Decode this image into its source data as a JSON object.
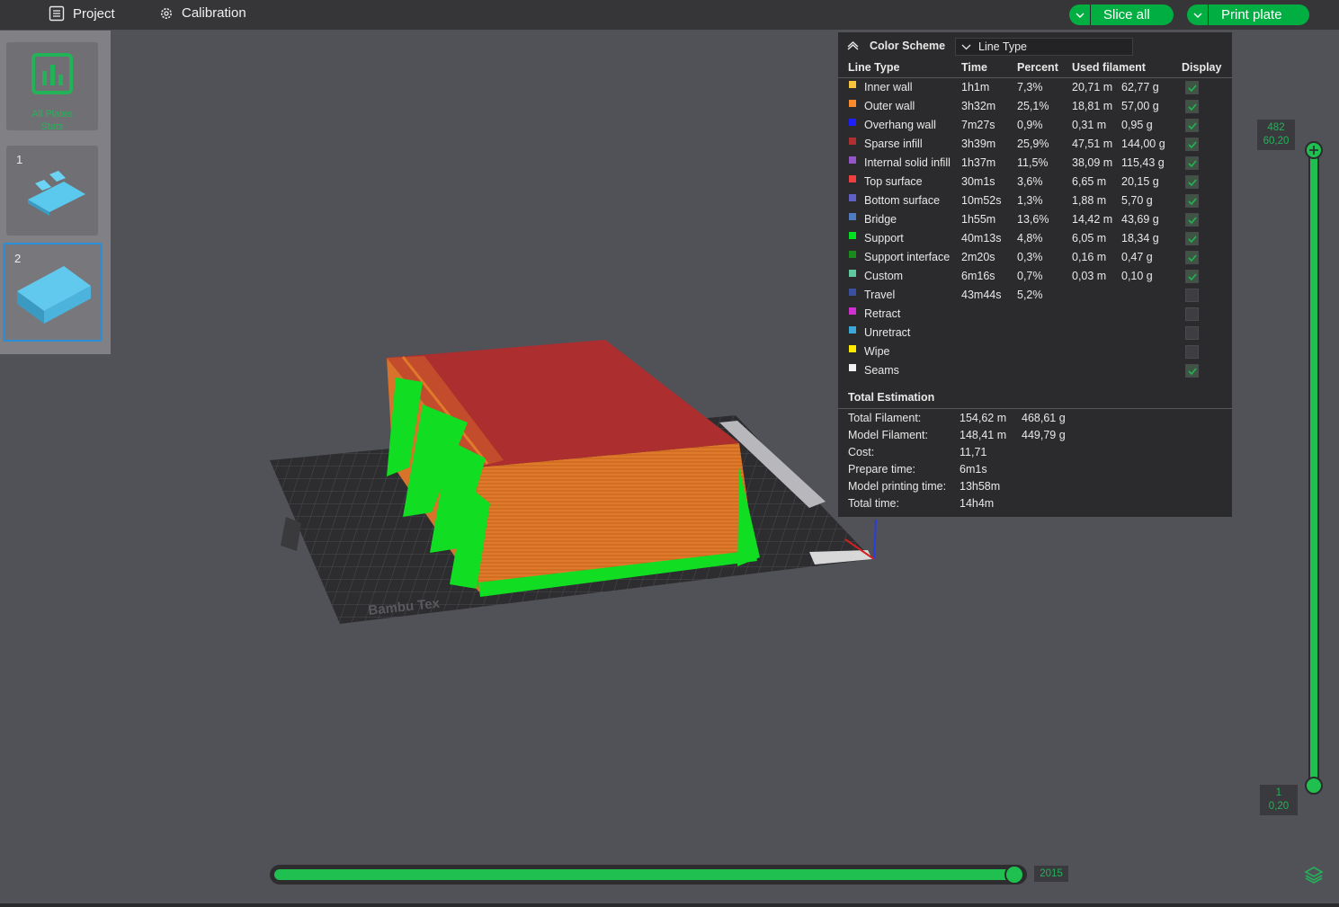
{
  "topbar": {
    "project_label": "Project",
    "calibration_label": "Calibration",
    "slice_all_label": "Slice all",
    "print_plate_label": "Print plate"
  },
  "plates": {
    "stats_label_line1": "All Plates",
    "stats_label_line2": "Stats",
    "items": [
      {
        "number": "1"
      },
      {
        "number": "2"
      }
    ]
  },
  "legend": {
    "color_scheme_label": "Color Scheme",
    "scheme_value": "Line Type",
    "columns": {
      "line_type": "Line Type",
      "time": "Time",
      "percent": "Percent",
      "used_filament": "Used filament",
      "display": "Display"
    },
    "rows": [
      {
        "name": "Inner wall",
        "color": "#f7c33d",
        "time": "1h1m",
        "percent": "7,3%",
        "length": "20,71 m",
        "weight": "62,77 g",
        "display": true
      },
      {
        "name": "Outer wall",
        "color": "#ff8a2b",
        "time": "3h32m",
        "percent": "25,1%",
        "length": "18,81 m",
        "weight": "57,00 g",
        "display": true
      },
      {
        "name": "Overhang wall",
        "color": "#1f1fff",
        "time": "7m27s",
        "percent": "0,9%",
        "length": "0,31 m",
        "weight": "0,95 g",
        "display": true
      },
      {
        "name": "Sparse infill",
        "color": "#b03030",
        "time": "3h39m",
        "percent": "25,9%",
        "length": "47,51 m",
        "weight": "144,00 g",
        "display": true
      },
      {
        "name": "Internal solid infill",
        "color": "#9455c8",
        "time": "1h37m",
        "percent": "11,5%",
        "length": "38,09 m",
        "weight": "115,43 g",
        "display": true
      },
      {
        "name": "Top surface",
        "color": "#ee4040",
        "time": "30m1s",
        "percent": "3,6%",
        "length": "6,65 m",
        "weight": "20,15 g",
        "display": true
      },
      {
        "name": "Bottom surface",
        "color": "#6060c8",
        "time": "10m52s",
        "percent": "1,3%",
        "length": "1,88 m",
        "weight": "5,70 g",
        "display": true
      },
      {
        "name": "Bridge",
        "color": "#4f7bc0",
        "time": "1h55m",
        "percent": "13,6%",
        "length": "14,42 m",
        "weight": "43,69 g",
        "display": true
      },
      {
        "name": "Support",
        "color": "#00e020",
        "time": "40m13s",
        "percent": "4,8%",
        "length": "6,05 m",
        "weight": "18,34 g",
        "display": true
      },
      {
        "name": "Support interface",
        "color": "#1a8a1a",
        "time": "2m20s",
        "percent": "0,3%",
        "length": "0,16 m",
        "weight": "0,47 g",
        "display": true
      },
      {
        "name": "Custom",
        "color": "#5ec8a0",
        "time": "6m16s",
        "percent": "0,7%",
        "length": "0,03 m",
        "weight": "0,10 g",
        "display": true
      },
      {
        "name": "Travel",
        "color": "#3a4fa0",
        "time": "43m44s",
        "percent": "5,2%",
        "length": "",
        "weight": "",
        "display": false
      },
      {
        "name": "Retract",
        "color": "#d030d0",
        "time": "",
        "percent": "",
        "length": "",
        "weight": "",
        "display": false
      },
      {
        "name": "Unretract",
        "color": "#3aa8d8",
        "time": "",
        "percent": "",
        "length": "",
        "weight": "",
        "display": false
      },
      {
        "name": "Wipe",
        "color": "#ffea00",
        "time": "",
        "percent": "",
        "length": "",
        "weight": "",
        "display": false
      },
      {
        "name": "Seams",
        "color": "#f2f2f2",
        "time": "",
        "percent": "",
        "length": "",
        "weight": "",
        "display": true
      }
    ],
    "total_title": "Total Estimation",
    "totals": [
      {
        "label": "Total Filament:",
        "v1": "154,62 m",
        "v2": "468,61 g"
      },
      {
        "label": "Model Filament:",
        "v1": "148,41 m",
        "v2": "449,79 g"
      },
      {
        "label": "Cost:",
        "v1": "11,71",
        "v2": ""
      },
      {
        "label": "Prepare time:",
        "v1": "6m1s",
        "v2": ""
      },
      {
        "label": "Model printing time:",
        "v1": "13h58m",
        "v2": ""
      },
      {
        "label": "Total time:",
        "v1": "14h4m",
        "v2": ""
      }
    ]
  },
  "layer_slider": {
    "top_layer": "482",
    "top_height": "60,20",
    "bottom_layer": "1",
    "bottom_height": "0,20"
  },
  "move_slider": {
    "value": "2015"
  },
  "plate_text": "Bambu Tex",
  "colors": {
    "accent_green": "#00ae42",
    "slider_green": "#1fbf50",
    "selection_blue": "#2a8fd6"
  }
}
